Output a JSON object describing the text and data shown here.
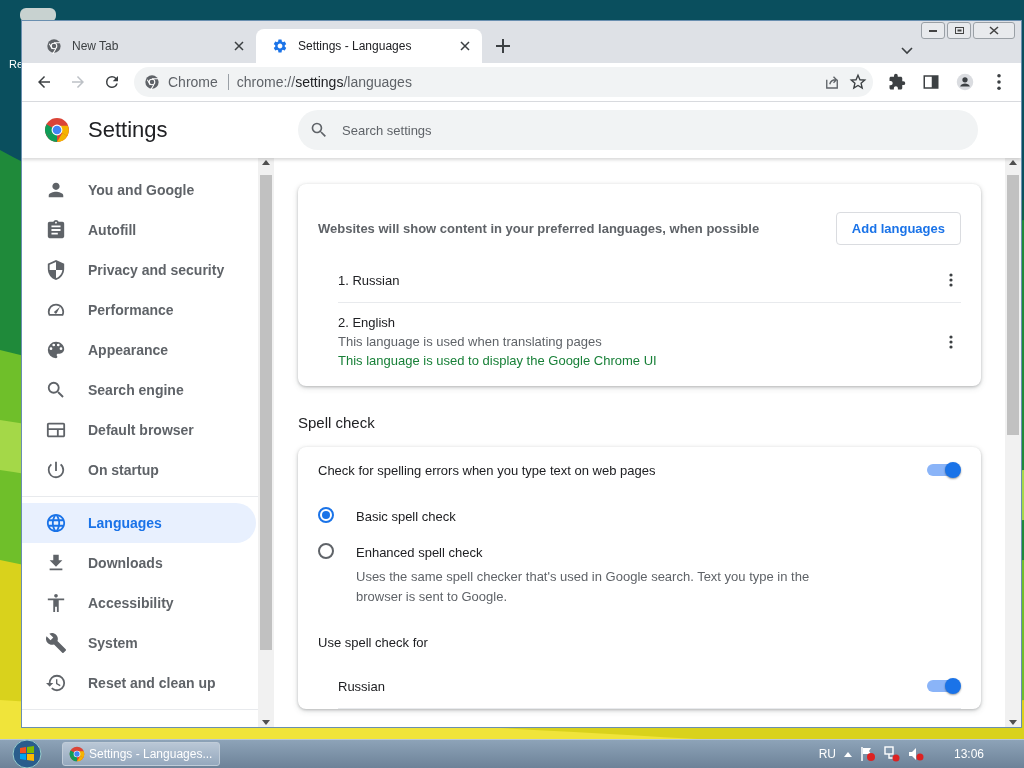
{
  "desktop": {
    "icon_label": "Re"
  },
  "tabs": [
    {
      "kind": "chrome",
      "title": "New Tab",
      "selected": false
    },
    {
      "kind": "settings",
      "title": "Settings - Languages",
      "selected": true
    }
  ],
  "toolbar": {
    "site_label": "Chrome",
    "url": [
      {
        "kind": "dim",
        "text": "chrome://"
      },
      {
        "kind": "host",
        "text": "settings"
      },
      {
        "kind": "dim",
        "text": "/languages"
      }
    ]
  },
  "settings_header": {
    "title": "Settings",
    "search": {
      "placeholder": "Search settings"
    }
  },
  "sidebar": {
    "groups": [
      [
        {
          "label": "You and Google",
          "selected": false
        },
        {
          "label": "Autofill",
          "selected": false
        },
        {
          "label": "Privacy and security",
          "selected": false
        },
        {
          "label": "Performance",
          "selected": false
        },
        {
          "label": "Appearance",
          "selected": false
        },
        {
          "label": "Search engine",
          "selected": false
        },
        {
          "label": "Default browser",
          "selected": false
        },
        {
          "label": "On startup",
          "selected": false
        }
      ],
      [
        {
          "label": "Languages",
          "selected": true
        },
        {
          "label": "Downloads",
          "selected": false
        },
        {
          "label": "Accessibility",
          "selected": false
        },
        {
          "label": "System",
          "selected": false
        },
        {
          "label": "Reset and clean up",
          "selected": false
        }
      ]
    ]
  },
  "preferred_languages": {
    "description": "Websites will show content in your preferred languages, when possible",
    "add_button": "Add languages",
    "languages": [
      {
        "name": "1. Russian"
      },
      {
        "name": "2. English",
        "notes": [
          {
            "kind": "plain",
            "text": "This language is used when translating pages"
          },
          {
            "kind": "highlight",
            "text": "This language is used to display the Google Chrome UI"
          }
        ]
      }
    ]
  },
  "spell_check": {
    "heading": "Spell check",
    "toggle_label": "Check for spelling errors when you type text on web pages",
    "on": true,
    "options": [
      {
        "label": "Basic spell check",
        "selected": true
      },
      {
        "label": "Enhanced spell check",
        "description": "Uses the same spell checker that's used in Google search. Text you type in the browser is sent to Google.",
        "selected": false
      }
    ],
    "use_for_heading": "Use spell check for",
    "languages": [
      {
        "name": "Russian",
        "on": true
      }
    ]
  },
  "taskbar": {
    "button": "Settings - Languages...",
    "language": "RU",
    "clock": "13:06"
  }
}
